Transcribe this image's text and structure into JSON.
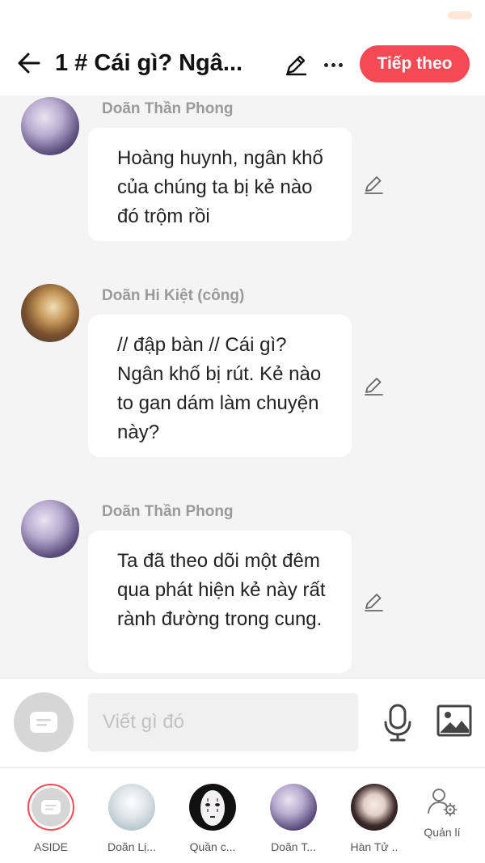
{
  "header": {
    "title": "1 # Cái gì? Ngâ...",
    "next_label": "Tiếp theo",
    "accent_color": "#f44a55"
  },
  "messages": [
    {
      "sender": "Doãn Thần Phong",
      "text": "Hoàng huynh, ngân khố của chúng ta bị kẻ nào đó trộm rồi"
    },
    {
      "sender": "Doãn Hi Kiệt (công)",
      "text": "// đập bàn // Cái gì? Ngân khố bị rút. Kẻ nào to gan dám làm chuyện này?"
    },
    {
      "sender": "Doãn Thần Phong",
      "text": "Ta đã theo dõi một đêm qua phát hiện kẻ này rất rành đường trong cung."
    }
  ],
  "composer": {
    "placeholder": "Viết gì đó"
  },
  "characters": [
    {
      "label": "ASIDE"
    },
    {
      "label": "Doãn Lị..."
    },
    {
      "label": "Quần c..."
    },
    {
      "label": "Doãn T..."
    },
    {
      "label": "Hàn Tử .."
    },
    {
      "label": "Quản lí"
    }
  ]
}
